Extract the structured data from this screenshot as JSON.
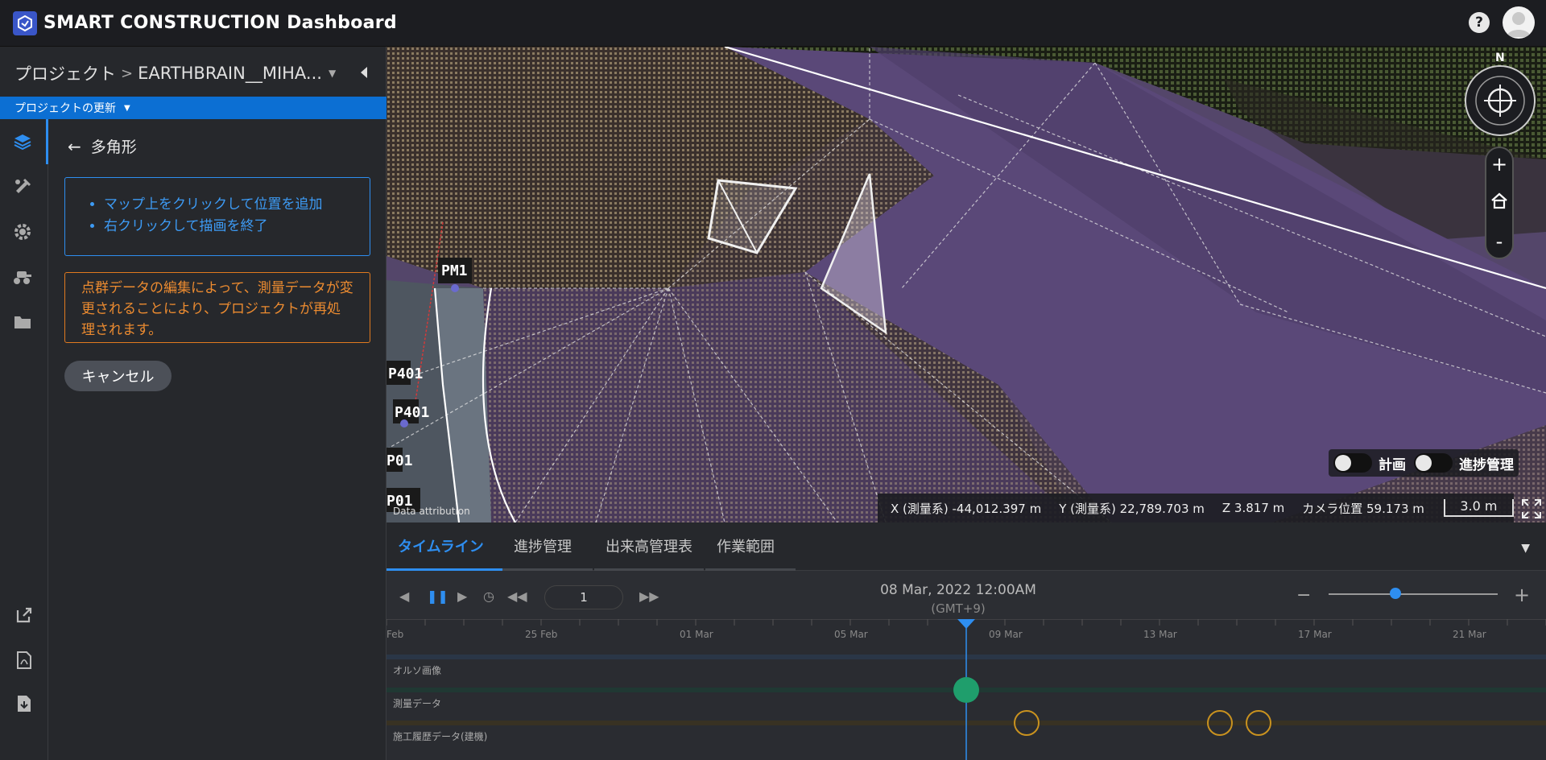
{
  "app": {
    "title": "SMART CONSTRUCTION Dashboard"
  },
  "breadcrumb": {
    "root": "プロジェクト",
    "sep": ">",
    "project": "EARTHBRAIN__MIHA..."
  },
  "update_bar": {
    "label": "プロジェクトの更新"
  },
  "panel": {
    "title": "多角形",
    "instructions": [
      "マップ上をクリックして位置を追加",
      "右クリックして描画を終了"
    ],
    "warning": "点群データの編集によって、測量データが変更されることにより、プロジェクトが再処理されます。",
    "cancel_label": "キャンセル"
  },
  "map": {
    "compass_n": "N",
    "zoom_in": "+",
    "zoom_out": "-",
    "toggle_plan": "計画",
    "toggle_progress": "進捗管理",
    "coord_x": "X (測量系) -44,012.397 m",
    "coord_y": "Y (測量系) 22,789.703 m",
    "coord_z": "Z 3.817 m",
    "camera": "カメラ位置 59.173 m",
    "scale": "3.0 m",
    "attribution": "Data attribution",
    "labels": [
      "PM1",
      "P401",
      "P401",
      "P01",
      "P01"
    ]
  },
  "tabs": [
    {
      "label": "タイムライン",
      "active": true
    },
    {
      "label": "進捗管理",
      "active": false
    },
    {
      "label": "出来高管理表",
      "active": false
    },
    {
      "label": "作業範囲",
      "active": false
    }
  ],
  "timeline": {
    "speed": "1",
    "date": "08 Mar, 2022 12:00AM",
    "tz": "(GMT+9)",
    "zoom_minus": "−",
    "zoom_plus": "+",
    "axis_labels": [
      "Feb",
      "25 Feb",
      "01 Mar",
      "05 Mar",
      "09 Mar",
      "13 Mar",
      "17 Mar",
      "21 Mar"
    ],
    "rows": [
      "オルソ画像",
      "測量データ",
      "施工履歴データ(建機)"
    ]
  },
  "colors": {
    "accent": "#2e8ef0",
    "warning": "#e07a1f",
    "survey": "#1f9e6c",
    "history": "#c9921f"
  }
}
